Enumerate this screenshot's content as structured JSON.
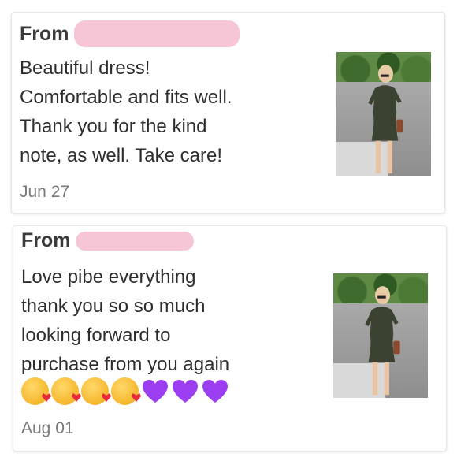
{
  "reviews": [
    {
      "from_label": "From",
      "message": "Beautiful dress!\nComfortable and fits well.\nThank you for the kind\nnote, as well. Take care!",
      "emojis": [],
      "date": "Jun 27"
    },
    {
      "from_label": "From",
      "message": "Love pibe everything\nthank you so so much\nlooking forward to\npurchase from you again",
      "emojis": [
        "kissing-face-with-heart",
        "kissing-face-with-heart",
        "kissing-face-with-heart",
        "kissing-face-with-heart",
        "purple-heart",
        "purple-heart",
        "purple-heart"
      ],
      "date": "Aug 01"
    }
  ],
  "colors": {
    "redaction": "#f7c6d6",
    "dress": "#3b4232",
    "purple_heart": "#9b3df0"
  }
}
